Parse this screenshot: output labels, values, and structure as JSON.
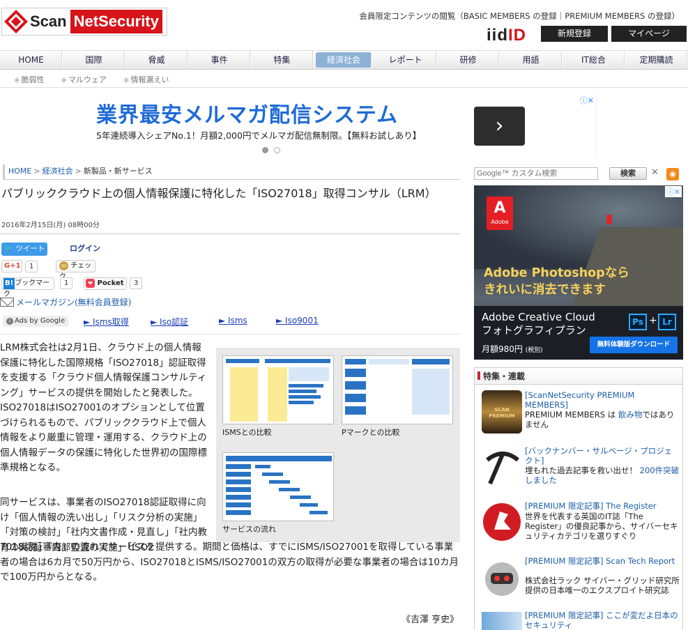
{
  "header": {
    "logo_scan": "Scan",
    "logo_net": "NetSecurity",
    "member_text_pre": "会員限定コンテンツの閲覧（",
    "basic_link": "BASIC MEMBERS の登録",
    "sep": "｜",
    "premium_link": "PREMIUM MEMBERS の登録",
    "member_text_post": "）",
    "iid_a": "iid",
    "iid_b": "ID",
    "register": "新規登録",
    "mypage": "マイページ"
  },
  "nav": [
    {
      "label": "HOME"
    },
    {
      "label": "国際"
    },
    {
      "label": "脅威"
    },
    {
      "label": "事件"
    },
    {
      "label": "特集"
    },
    {
      "label": "経済社会",
      "active": true
    },
    {
      "label": "レポート"
    },
    {
      "label": "研修"
    },
    {
      "label": "用語"
    },
    {
      "label": "IT総合"
    },
    {
      "label": "定期購読"
    }
  ],
  "subnav": [
    "脆弱性",
    "マルウェア",
    "情報漏えい"
  ],
  "banner": {
    "title": "業界最安メルマガ配信システム",
    "sub": "5年連続導入シェアNo.1！月額2,000円でメルマガ配信無制限。【無料お試しあり】",
    "arrow": "›",
    "ad_mark": "ⓘ✕"
  },
  "breadcrumb": {
    "home": "HOME",
    "sep": ">",
    "cat": "経済社会",
    "current": "新製品・新サービス"
  },
  "article": {
    "title": "パブリッククラウド上の個人情報保護に特化した「ISO27018」取得コンサル（LRM）",
    "date": "2016年2月15日(月) 08時00分",
    "p1": "LRM株式会社は2月1日、クラウド上の個人情報保護に特化した国際規格「ISO27018」認証取得を支援する「クラウド個人情報保護コンサルティング」サービスの提供を開始したと発表した。ISO27018はISO27001のオプションとして位置づけられるもので、パブリッククラウド上で個人情報をより厳重に管理・運用する、クラウド上の個人情報データの保護に特化した世界初の国際標準規格となる。",
    "p2": "同サービスは、事業者のISO27018認証取得に向け「個人情報の洗い出し」「リスク分析の実施」「対策の検討」「社内文書作成・見直し」「社内教育の実施」「内部監査の実施」「ISO2",
    "p2b": "7018認証審査」の流れでサービスを提供する。期間と価格は、すでにISMS/ISO27001を取得している事業者の場合は6カ月で50万円から、ISO27018とISMS/ISO27001の双方の取得が必要な事業者の場合は10カ月で100万円からとなる。",
    "author": "《吉澤 亨史》"
  },
  "social": {
    "tweet": "ツイート",
    "login": "ログイン",
    "gplus": "G+1",
    "gplus_count": "1",
    "check": "チェック",
    "hatena_icon": "B!",
    "hatena": "ブックマーク",
    "hatena_count": "1",
    "pocket": "Pocket",
    "pocket_count": "3",
    "mailmag": "メールマガジン(無料会員登録)"
  },
  "ads": {
    "adsby": "Ads by Google",
    "links": [
      "► Isms取得",
      "► Iso認証",
      "► Isms",
      "► Iso9001"
    ]
  },
  "figures": [
    {
      "caption": "ISMSとの比較"
    },
    {
      "caption": "Pマークとの比較"
    },
    {
      "caption": "サービスの流れ"
    }
  ],
  "sidebar": {
    "search_placeholder": "Google™ カスタム検索",
    "search_btn": "検索",
    "clear": "✕",
    "rss": "◉",
    "ad": {
      "brand": "Adobe",
      "brand_letter": "A",
      "headline1": "Adobe Photoshopなら",
      "headline2": "きれいに消去できます",
      "product1": "Adobe Creative Cloud",
      "product2": "フォトグラフィプラン",
      "price": "月額980円",
      "price_tax": "(税別)",
      "ps": "Ps",
      "plus": "+",
      "lr": "Lr",
      "cta": "無料体験版ダウンロード",
      "ad_mark": "ⓘ✕"
    },
    "feature_title": "特集・連載",
    "features": [
      {
        "title": "[ScanNetSecurity PREMIUM MEMBERS]",
        "desc_pre": "PREMIUM MEMBERS は ",
        "desc_hl": "飲み物",
        "desc_post": "ではありません",
        "thumb_text": "SCAN PREMIUM"
      },
      {
        "title": "[バックナンバー・サルベージ・プロジェクト]",
        "desc_pre": "埋もれた過去記事を救い出せ！ ",
        "desc_hl": "200件突破しました",
        "desc_post": ""
      },
      {
        "title": "[PREMIUM 限定記事] The Register",
        "desc_pre": "世界を代表する英国のIT誌「The Register」の優良記事から、サイバーセキュリティカテゴリを選りすぐり",
        "desc_hl": "",
        "desc_post": ""
      },
      {
        "title": "[PREMIUM 限定記事] Scan Tech Report",
        "desc_pre": "株式会社ラック サイバー・グリッド研究所 提供の日本唯一のエクスプロイト研究誌",
        "desc_hl": "",
        "desc_post": ""
      },
      {
        "title": "[PREMIUM 限定記事] ここが変だよ日本のセキュリティ",
        "desc_pre": "",
        "desc_hl": "",
        "desc_post": ""
      }
    ]
  },
  "colors": {
    "brand_red": "#d7141a",
    "link_blue": "#1a5ca8",
    "nav_active": "#8db2d6",
    "banner_blue": "#1e6bd6"
  }
}
